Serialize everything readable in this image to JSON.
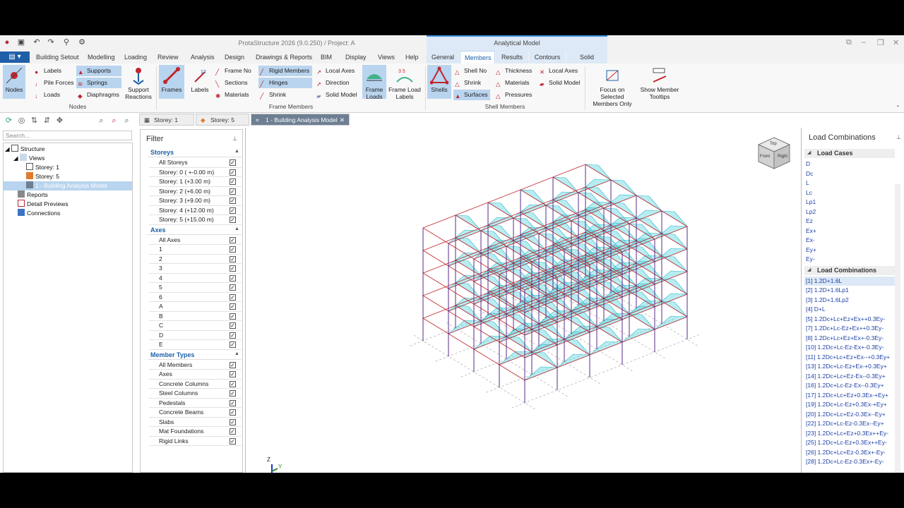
{
  "window": {
    "title": "ProtaStructure 2026 (9.0.250) / Project: A",
    "context_title": "Analytical Model"
  },
  "tabs": [
    "Building Setout",
    "Modelling",
    "Loading",
    "Review",
    "Analysis",
    "Design",
    "Drawings & Reports",
    "BIM",
    "Display",
    "Views",
    "Help"
  ],
  "context_tabs": [
    "General",
    "Members",
    "Results",
    "Contours",
    "Solid Model"
  ],
  "ribbon": {
    "nodes_group": {
      "label": "Nodes",
      "big": "Nodes",
      "items": [
        "Labels",
        "Pile Forces",
        "Loads",
        "Supports",
        "Springs",
        "Diaphragms"
      ],
      "support_reactions": "Support Reactions"
    },
    "frame_group": {
      "label": "Frame Members",
      "frames": "Frames",
      "labels": "Labels",
      "items": [
        "Frame No",
        "Sections",
        "Materials",
        "Rigid Members",
        "Hinges",
        "Shrink",
        "Local Axes",
        "Direction",
        "Solid Model"
      ],
      "frame_loads": "Frame Loads",
      "frame_load_labels": "Frame Load Labels"
    },
    "shell_group": {
      "label": "Shell Members",
      "shells": "Shells",
      "items": [
        "Shell No",
        "Shrink",
        "Surfaces",
        "Thickness",
        "Materials",
        "Pressures",
        "Local Axes",
        "Solid Model"
      ]
    },
    "focus": "Focus on Selected Members Only",
    "tooltips": "Show Member Tooltips"
  },
  "search_placeholder": "Search...",
  "tree": {
    "root": "Structure",
    "views": "Views",
    "storey1": "Storey: 1",
    "storey5": "Storey: 5",
    "model": "1 - Building Analysis Model",
    "reports": "Reports",
    "detail": "Detail Previews",
    "connections": "Connections"
  },
  "doc_tabs": [
    "Storey: 1",
    "Storey: 5",
    "1 - Building Analysis Model"
  ],
  "filter": {
    "title": "Filter",
    "storeys_label": "Storeys",
    "storeys": [
      "All Storeys",
      "Storey: 0 ( +-0.00 m)",
      "Storey: 1 (+3.00 m)",
      "Storey: 2 (+6.00 m)",
      "Storey: 3 (+9.00 m)",
      "Storey: 4 (+12.00 m)",
      "Storey: 5 (+15.00 m)"
    ],
    "axes_label": "Axes",
    "axes": [
      "All Axes",
      "1",
      "2",
      "3",
      "4",
      "5",
      "6",
      "A",
      "B",
      "C",
      "D",
      "E"
    ],
    "types_label": "Member Types",
    "types": [
      "All Members",
      "Axes",
      "Concrete Columns",
      "Steel Columns",
      "Pedestals",
      "Concrete Beams",
      "Slabs",
      "Mat Foundations",
      "Rigid Links"
    ]
  },
  "load_panel": {
    "title": "Load Combinations",
    "cases_label": "Load Cases",
    "cases": [
      "D",
      "Dc",
      "L",
      "Lc",
      "Lp1",
      "Lp2",
      "Ez",
      "Ex+",
      "Ex-",
      "Ey+",
      "Ey-"
    ],
    "combos_label": "Load Combinations",
    "combos": [
      "[1] 1.2D+1.6L",
      "[2] 1.2D+1.6Lp1",
      "[3] 1.2D+1.6Lp2",
      "[4] D+L",
      "[5] 1.2Dc+Lc+Ez+Ex++0.3Ey-",
      "[7] 1.2Dc+Lc-Ez+Ex++0.3Ey-",
      "[8] 1.2Dc+Lc+Ez+Ex+-0.3Ey-",
      "[10] 1.2Dc+Lc-Ez-Ex+-0.3Ey-",
      "[11] 1.2Dc+Lc+Ez+Ex--+0.3Ey+",
      "[13] 1.2Dc+Lc-Ez+Ex-+0.3Ey+",
      "[14] 1.2Dc+Lc+Ez-Ex--0.3Ey+",
      "[16] 1.2Dc+Lc-Ez-Ex--0.3Ey+",
      "[17] 1.2Dc+Lc+Ez+0.3Ex-+Ey+",
      "[19] 1.2Dc+Lc-Ez+0.3Ex-+Ey+",
      "[20] 1.2Dc+Lc+Ez-0.3Ex--Ey+",
      "[22] 1.2Dc+Lc-Ez-0.3Ex--Ey+",
      "[23] 1.2Dc+Lc+Ez+0.3Ex++Ey-",
      "[25] 1.2Dc+Lc-Ez+0.3Ex++Ey-",
      "[26] 1.2Dc+Lc+Ez-0.3Ex+-Ey-",
      "[28] 1.2Dc+Lc-Ez-0.3Ex+-Ey-"
    ]
  },
  "viewcube": {
    "top": "Top",
    "front": "Front",
    "right": "Right"
  },
  "axis_labels": {
    "z": "Z",
    "y": "Y"
  }
}
